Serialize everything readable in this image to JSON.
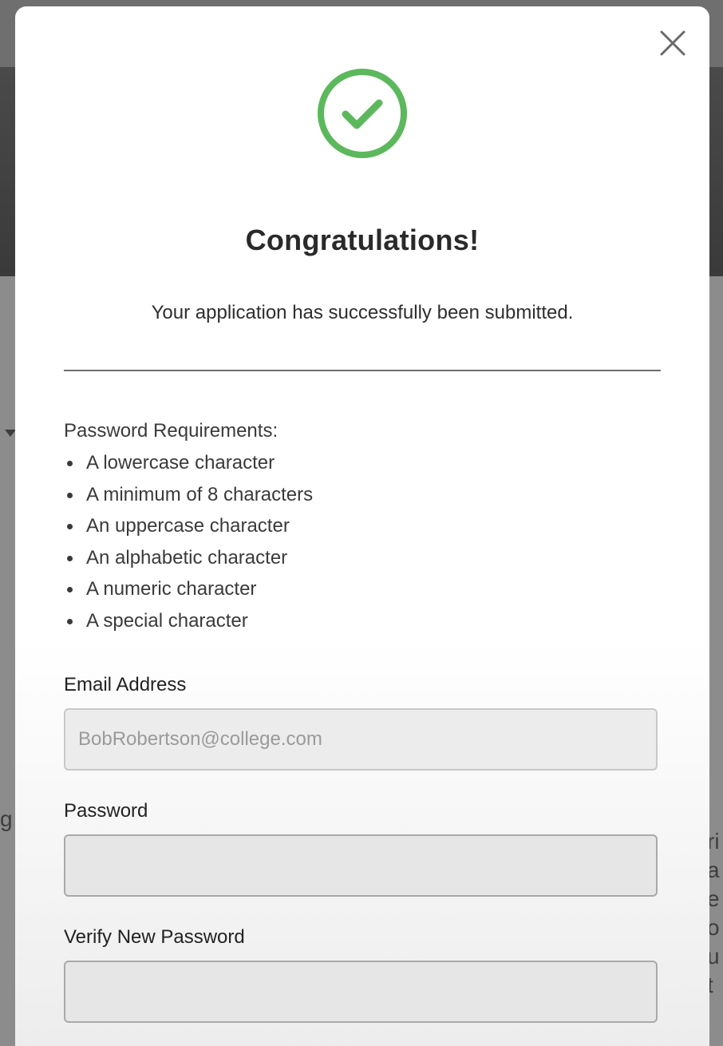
{
  "backdrop": {
    "peek_left": "g",
    "peek_right": [
      "ri",
      "a",
      "e",
      "o",
      "u",
      "t"
    ]
  },
  "modal": {
    "close_icon": "close-x-icon",
    "success_icon": "check-circle-icon",
    "title": "Congratulations!",
    "subtitle": "Your application has successfully been submitted.",
    "requirements": {
      "heading": "Password Requirements:",
      "items": [
        "A lowercase character",
        "A minimum of 8 characters",
        "An uppercase character",
        "An alphabetic character",
        "A numeric character",
        "A special character"
      ]
    },
    "email": {
      "label": "Email Address",
      "value": "BobRobertson@college.com"
    },
    "password": {
      "label": "Password",
      "value": ""
    },
    "verify_password": {
      "label": "Verify New Password",
      "value": ""
    }
  },
  "colors": {
    "success_green": "#5cb85c",
    "title_text": "#2a2a2a",
    "divider": "#6e6e6e"
  }
}
